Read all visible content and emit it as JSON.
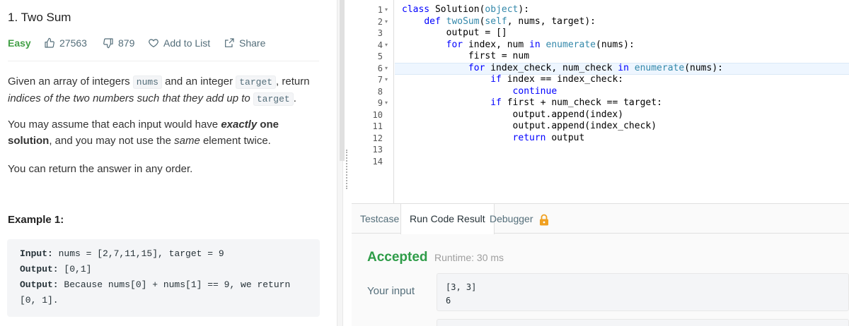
{
  "problem": {
    "title": "1. Two Sum",
    "difficulty": "Easy",
    "likes": "27563",
    "dislikes": "879",
    "add_to_list": "Add to List",
    "share": "Share",
    "difficulty_color": "#43a047"
  },
  "description": {
    "p1_a": "Given an array of integers ",
    "p1_code1": "nums",
    "p1_b": " and an integer ",
    "p1_code2": "target",
    "p1_c": ", return ",
    "p1_italic": "indices of the two numbers such that they add up to ",
    "p1_code3": "target",
    "p1_d": ".",
    "p2_a": "You may assume that each input would have ",
    "p2_bold_italic": "exactly",
    "p2_bold": " one solution",
    "p2_b": ", and you may not use the ",
    "p2_italic": "same",
    "p2_c": " element twice.",
    "p3": "You can return the answer in any order."
  },
  "example": {
    "title": "Example 1:",
    "input_label": "Input:",
    "input_value": " nums = [2,7,11,15], target = 9",
    "output_label": "Output:",
    "output_value": " [0,1]",
    "explanation_label": "Output:",
    "explanation_value": " Because nums[0] + nums[1] == 9, we return",
    "explanation_cont": "[0, 1]."
  },
  "editor": {
    "line_numbers": [
      "1",
      "2",
      "3",
      "4",
      "5",
      "6",
      "7",
      "8",
      "9",
      "10",
      "11",
      "12",
      "13",
      "14"
    ],
    "fold_marker": "▾",
    "code": [
      "class Solution(object):",
      "    def twoSum(self, nums, target):",
      "        output = []",
      "        for index, num in enumerate(nums):",
      "            first = num",
      "            for index_check, num_check in enumerate(nums):",
      "                if index == index_check:",
      "                    continue",
      "                if first + num_check == target:",
      "                    output.append(index)",
      "                    output.append(index_check)",
      "                    return output",
      "",
      ""
    ],
    "highlighted_line": 6
  },
  "console": {
    "tabs": [
      "Testcase",
      "Run Code Result",
      "Debugger"
    ],
    "active_tab": "Run Code Result",
    "status": "Accepted",
    "runtime": "Runtime: 30 ms",
    "your_input_label": "Your input",
    "input_lines": [
      "[3, 3]",
      "6"
    ],
    "status_color": "#2e9c48"
  },
  "icons": {
    "likes": "thumbs-up-icon",
    "dislikes": "thumbs-down-icon",
    "add_to_list": "heart-icon",
    "share": "share-icon",
    "debugger_lock": "lock-icon"
  }
}
